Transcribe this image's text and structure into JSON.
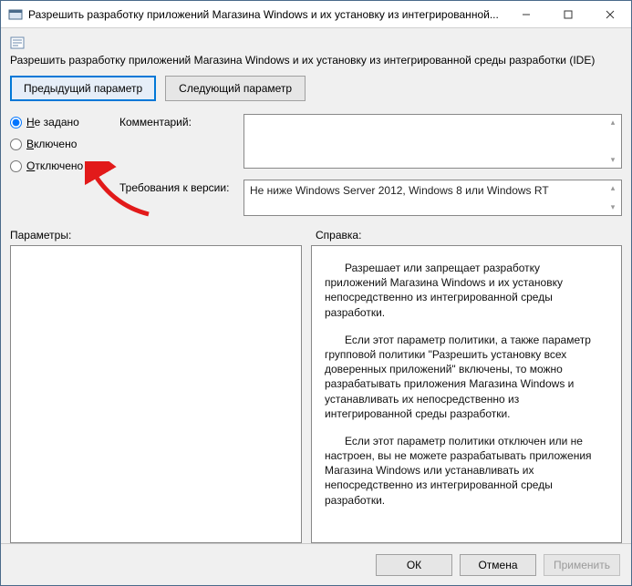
{
  "window": {
    "title": "Разрешить разработку приложений Магазина Windows и их установку из интегрированной..."
  },
  "header": {
    "full_title": "Разрешить разработку приложений Магазина Windows и их установку из интегрированной среды разработки (IDE)"
  },
  "nav": {
    "prev": "Предыдущий параметр",
    "next": "Следующий параметр"
  },
  "state_options": {
    "not_configured": {
      "prefix": "Н",
      "rest": "е задано"
    },
    "enabled": {
      "prefix": "В",
      "rest": "ключено"
    },
    "disabled": {
      "prefix": "О",
      "rest": "тключено"
    },
    "selected": "not_configured"
  },
  "fields": {
    "comment_label": "Комментарий:",
    "comment_value": "",
    "supported_label": "Требования к версии:",
    "supported_value": "Не ниже Windows Server 2012, Windows 8 или Windows RT"
  },
  "panes": {
    "options_label": "Параметры:",
    "help_label": "Справка:"
  },
  "help_paragraphs": {
    "p1": "Разрешает или запрещает разработку приложений Магазина Windows и их установку непосредственно из интегрированной среды разработки.",
    "p2": "Если этот параметр политики, а также параметр групповой политики \"Разрешить установку всех доверенных приложений\" включены, то можно разрабатывать приложения Магазина Windows и устанавливать их непосредственно из интегрированной среды разработки.",
    "p3": "Если этот параметр политики отключен или не настроен, вы не можете разрабатывать приложения Магазина Windows или устанавливать их непосредственно из интегрированной среды разработки."
  },
  "footer": {
    "ok": "ОК",
    "cancel": "Отмена",
    "apply": "Применить"
  }
}
